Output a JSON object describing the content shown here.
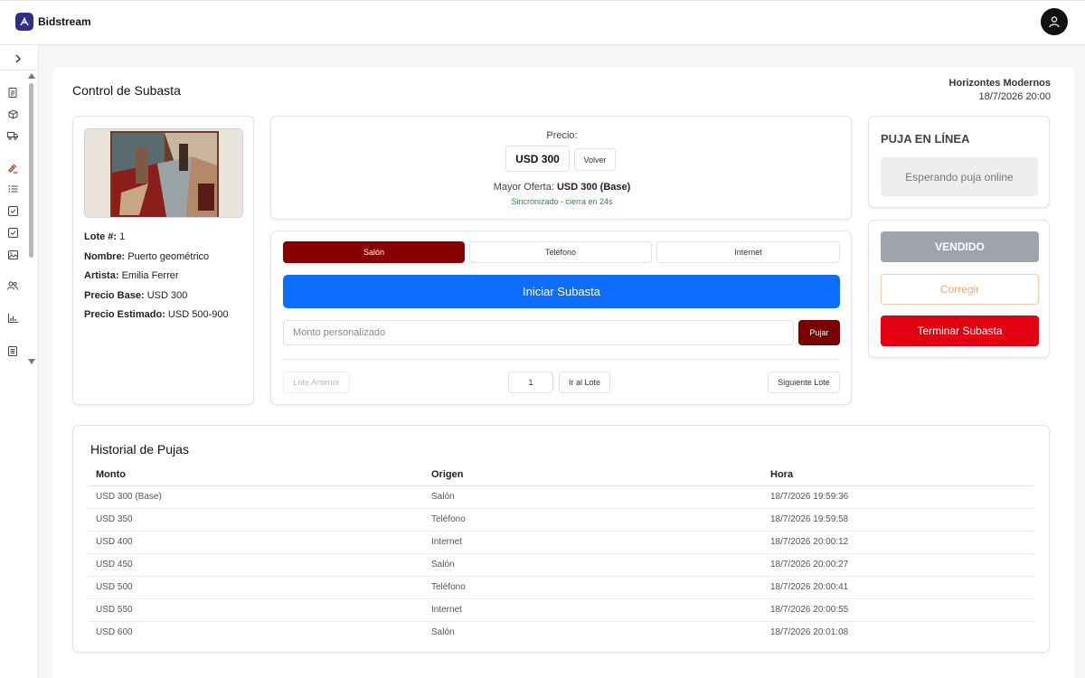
{
  "app": {
    "brand": "Bidstream"
  },
  "header": {
    "page_title": "Control de Subasta",
    "event_name": "Horizontes Modernos",
    "event_date": "18/7/2026 20:00"
  },
  "lot": {
    "number_label": "Lote #:",
    "number_value": "1",
    "name_label": "Nombre:",
    "name_value": "Puerto geométrico",
    "artist_label": "Artista:",
    "artist_value": "Emilia Ferrer",
    "base_label": "Precio Base:",
    "base_value": "USD 300",
    "estimate_label": "Precio Estimado:",
    "estimate_value": "USD 500-900"
  },
  "price": {
    "label": "Precio:",
    "value": "USD 300",
    "back_button": "Volver",
    "highest_label": "Mayor Oferta:",
    "highest_value": "USD 300 (Base)",
    "sync_status": "Sincronizado - cierra en 24s"
  },
  "controls": {
    "tabs": [
      "Salón",
      "Teléfono",
      "Internet"
    ],
    "active_tab": "Salón",
    "start_button": "Iniciar Subasta",
    "custom_placeholder": "Monto personalizado",
    "bid_button": "Pujar",
    "prev_button": "Lote Anterior",
    "lot_input_value": "1",
    "go_button": "Ir al Lote",
    "next_button": "Siguiente Lote"
  },
  "online": {
    "title": "PUJA EN LÍNEA",
    "status": "Esperando puja online"
  },
  "actions": {
    "sold": "VENDIDO",
    "correct": "Corregir",
    "end": "Terminar Subasta"
  },
  "history": {
    "title": "Historial de Pujas",
    "columns": [
      "Monto",
      "Origen",
      "Hora"
    ],
    "rows": [
      [
        "USD 300 (Base)",
        "Salón",
        "18/7/2026 19:59:36"
      ],
      [
        "USD 350",
        "Teléfono",
        "18/7/2026 19:59:58"
      ],
      [
        "USD 400",
        "Internet",
        "18/7/2026 20:00:12"
      ],
      [
        "USD 450",
        "Salón",
        "18/7/2026 20:00:27"
      ],
      [
        "USD 500",
        "Teléfono",
        "18/7/2026 20:00:41"
      ],
      [
        "USD 550",
        "Internet",
        "18/7/2026 20:00:55"
      ],
      [
        "USD 600",
        "Salón",
        "18/7/2026 20:01:08"
      ]
    ]
  },
  "colors": {
    "brand": "#2e2f8a",
    "active_tab": "#8a0000",
    "primary": "#0d6efd",
    "danger": "#e30010",
    "success_text": "#2e8b3a"
  }
}
